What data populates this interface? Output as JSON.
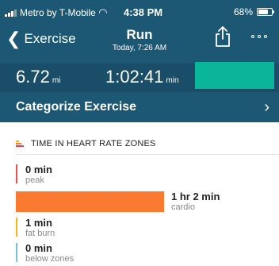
{
  "status": {
    "carrier": "Metro by T-Mobile",
    "time": "4:38 PM",
    "battery": "68%"
  },
  "nav": {
    "back_label": "Exercise",
    "title": "Run",
    "subtitle": "Today, 7:26 AM"
  },
  "stats": [
    {
      "value": "6.72",
      "unit": "mi"
    },
    {
      "value": "1:02:41",
      "unit": "min"
    }
  ],
  "categorize_label": "Categorize Exercise",
  "zones_header": "TIME IN HEART RATE ZONES",
  "zones": [
    {
      "value": "0 min",
      "label": "peak",
      "color": "#e8505b",
      "fraction": 0
    },
    {
      "value": "1 hr 2 min",
      "label": "cardio",
      "color": "#f97a30",
      "fraction": 0.97
    },
    {
      "value": "1 min",
      "label": "fat burn",
      "color": "#f7b51a",
      "fraction": 0.02
    },
    {
      "value": "0 min",
      "label": "below zones",
      "color": "#74c4d4",
      "fraction": 0
    }
  ],
  "colors": {
    "header_bg": "#1c5873",
    "stats_bg": "#1a4d67",
    "hr_block": "#0bb59a"
  }
}
